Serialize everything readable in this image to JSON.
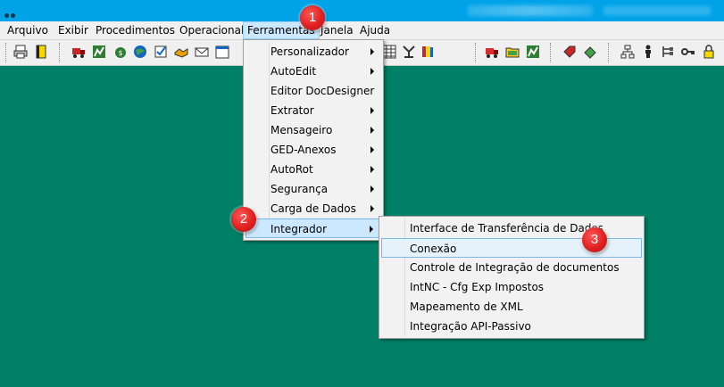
{
  "menubar": {
    "items": [
      "Arquivo",
      "Exibir",
      "Procedimentos",
      "Operacional",
      "Ferramentas",
      "Janela",
      "Ajuda"
    ],
    "active": "Ferramentas"
  },
  "ferramentas_menu": {
    "items": [
      {
        "label": "Personalizador",
        "submenu": true
      },
      {
        "label": "AutoEdit",
        "submenu": true
      },
      {
        "label": "Editor DocDesigner",
        "submenu": false
      },
      {
        "label": "Extrator",
        "submenu": true
      },
      {
        "label": "Mensageiro",
        "submenu": true
      },
      {
        "label": "GED-Anexos",
        "submenu": true
      },
      {
        "label": "AutoRot",
        "submenu": true
      },
      {
        "label": "Segurança",
        "submenu": true
      },
      {
        "label": "Carga de Dados",
        "submenu": true
      },
      {
        "label": "Integrador",
        "submenu": true
      }
    ]
  },
  "integrador_menu": {
    "items": [
      "Interface de Transferência de Dados",
      "Conexão",
      "Controle de Integração de documentos",
      "IntNC - Cfg Exp Impostos",
      "Mapeamento de XML",
      "Integração API-Passivo"
    ]
  },
  "annotations": {
    "step1": "1",
    "step2": "2",
    "step3": "3"
  },
  "colors": {
    "titlebar": "#00a2e8",
    "desktop": "#008066",
    "menu_highlight": "#cce8ff",
    "badge": "#e02020"
  },
  "toolbar_icons": [
    "print-icon",
    "book-icon",
    "truck-icon",
    "document-chart-icon",
    "money-bag-icon",
    "globe-icon",
    "check-icon",
    "handshake-icon",
    "envelope-icon",
    "calendar-icon",
    "grid-icon",
    "network-icon",
    "books-icon",
    "truck-red-icon",
    "folder-icon",
    "chart-icon",
    "tag-icon",
    "recycle-icon",
    "org-chart-icon",
    "person-icon",
    "tree-icon",
    "key-icon",
    "lock-icon"
  ]
}
